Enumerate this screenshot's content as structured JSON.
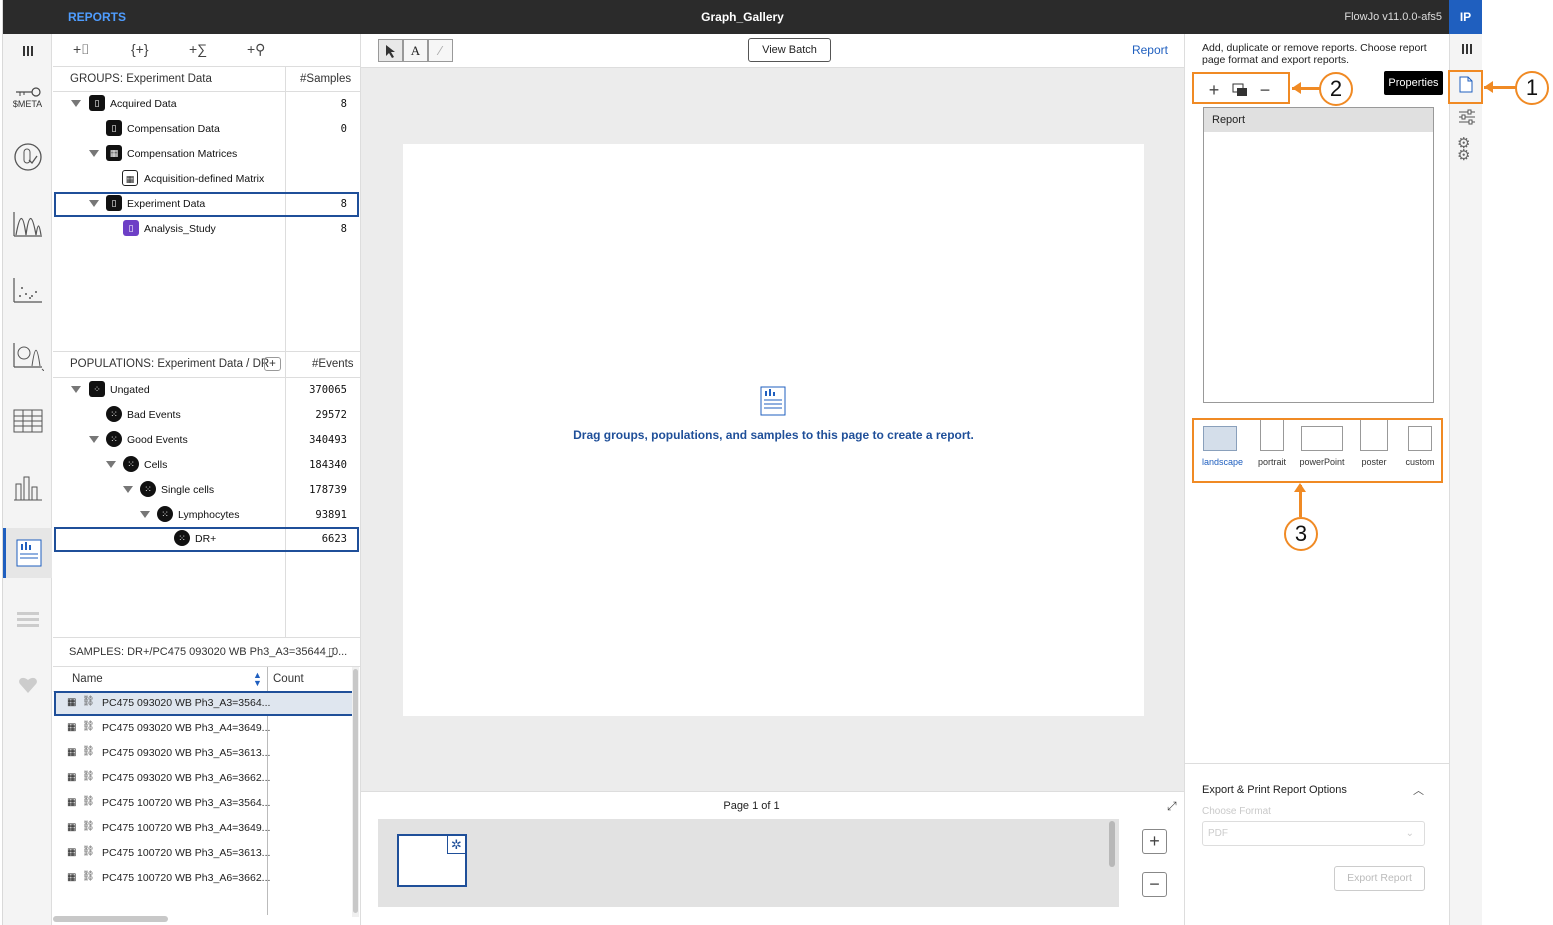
{
  "topbar": {
    "mode": "REPORTS",
    "title": "Graph_Gallery",
    "version": "FlowJo v11.0.0-afs5",
    "user": "IP"
  },
  "leftnav": {
    "meta_label": "$META"
  },
  "groups": {
    "title": "GROUPS: Experiment Data",
    "count_header": "#Samples",
    "rows": [
      {
        "name": "Acquired Data",
        "count": "8"
      },
      {
        "name": "Compensation Data",
        "count": "0"
      },
      {
        "name": "Compensation Matrices",
        "count": ""
      },
      {
        "name": "Acquisition-defined Matrix",
        "count": ""
      },
      {
        "name": "Experiment Data",
        "count": "8"
      },
      {
        "name": "Analysis_Study",
        "count": "8"
      }
    ]
  },
  "populations": {
    "title": "POPULATIONS: Experiment Data / DR+",
    "count_header": "#Events",
    "rows": [
      {
        "name": "Ungated",
        "count": "370065"
      },
      {
        "name": "Bad Events",
        "count": "29572"
      },
      {
        "name": "Good Events",
        "count": "340493"
      },
      {
        "name": "Cells",
        "count": "184340"
      },
      {
        "name": "Single cells",
        "count": "178739"
      },
      {
        "name": "Lymphocytes",
        "count": "93891"
      },
      {
        "name": "DR+",
        "count": "6623"
      }
    ]
  },
  "samples": {
    "title": "SAMPLES: DR+/PC475 093020 WB Ph3_A3=35644_0...",
    "col_name": "Name",
    "col_count": "Count",
    "rows": [
      "PC475 093020 WB Ph3_A3=3564...",
      "PC475 093020 WB Ph3_A4=3649...",
      "PC475 093020 WB Ph3_A5=3613...",
      "PC475 093020 WB Ph3_A6=3662...",
      "PC475 100720 WB Ph3_A3=3564...",
      "PC475 100720 WB Ph3_A4=3649...",
      "PC475 100720 WB Ph3_A5=3613...",
      "PC475 100720 WB Ph3_A6=3662..."
    ]
  },
  "center": {
    "view_batch": "View Batch",
    "report_link": "Report",
    "drop_hint": "Drag groups, populations, and samples to this page to create a report.",
    "page_label": "Page 1 of 1"
  },
  "right": {
    "help": "Add, duplicate or remove reports. Choose report page format and export reports.",
    "report_item": "Report",
    "formats": [
      "landscape",
      "portrait",
      "powerPoint",
      "poster",
      "custom"
    ],
    "selected_format": "landscape",
    "export_title": "Export & Print Report Options",
    "choose_format": "Choose Format",
    "format_value": "PDF",
    "export_button": "Export Report",
    "tooltip": "Properties"
  },
  "annotations": {
    "c1": "1",
    "c2": "2",
    "c3": "3",
    "color": "#f08a24"
  }
}
